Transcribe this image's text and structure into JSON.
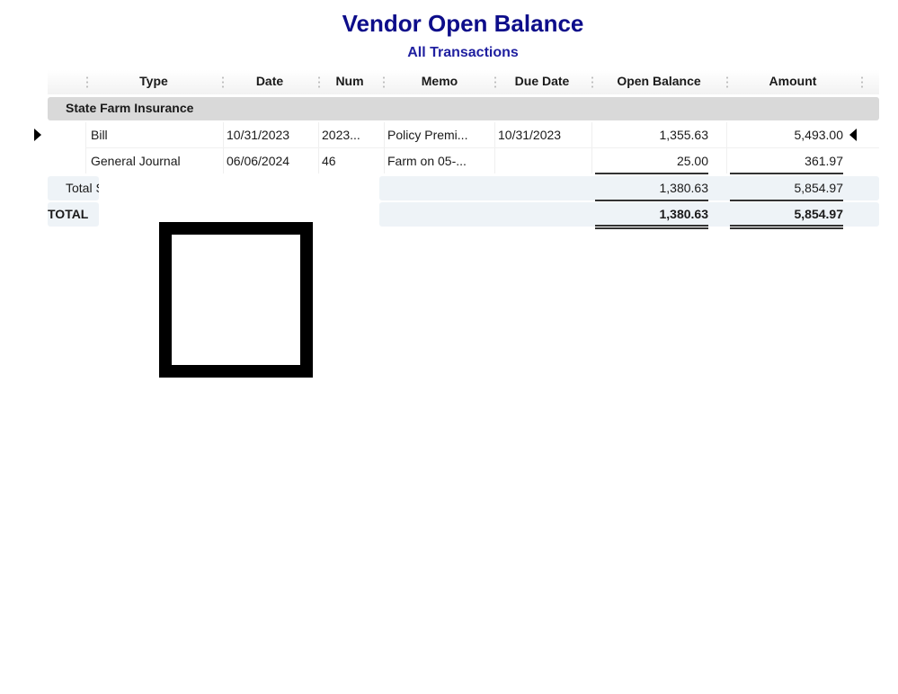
{
  "report": {
    "title": "Vendor Open Balance",
    "subtitle": "All Transactions"
  },
  "columns": [
    {
      "key": "type",
      "label": "Type"
    },
    {
      "key": "date",
      "label": "Date"
    },
    {
      "key": "num",
      "label": "Num"
    },
    {
      "key": "memo",
      "label": "Memo"
    },
    {
      "key": "due_date",
      "label": "Due Date"
    },
    {
      "key": "open_balance",
      "label": "Open Balance"
    },
    {
      "key": "amount",
      "label": "Amount"
    }
  ],
  "group": {
    "name": "State Farm Insurance",
    "rows": [
      {
        "type": "Bill",
        "date": "10/31/2023",
        "num": "2023...",
        "memo": "Policy Premi...",
        "due_date": "10/31/2023",
        "open_balance": "1,355.63",
        "amount": "5,493.00",
        "selected": true
      },
      {
        "type": "General Journal",
        "date": "06/06/2024",
        "num": "46",
        "memo": "Farm on 05-...",
        "due_date": "",
        "open_balance": "25.00",
        "amount": "361.97",
        "selected": false
      }
    ],
    "total_label": "Total State Farm Insurance",
    "total_label_visible": "Total !",
    "total_open_balance": "1,380.63",
    "total_amount": "5,854.97"
  },
  "grand_total": {
    "label": "TOTAL",
    "open_balance": "1,380.63",
    "amount": "5,854.97"
  },
  "icons": {
    "row_pointer_left": "triangle-right-icon",
    "row_pointer_right": "triangle-left-icon",
    "overlay": "square-outline"
  }
}
